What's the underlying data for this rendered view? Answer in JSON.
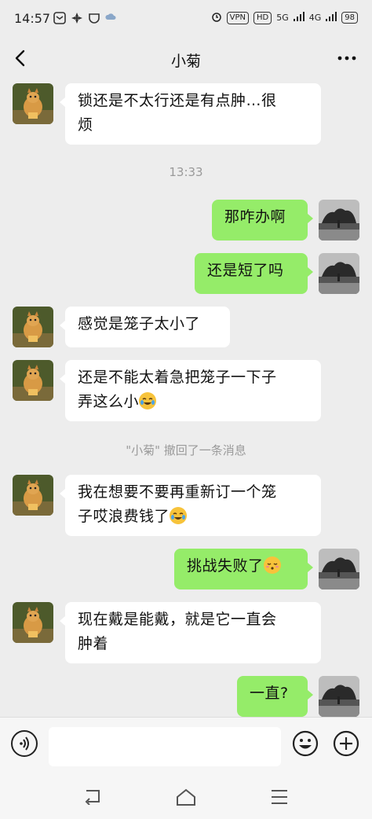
{
  "status_bar": {
    "time": "14:57",
    "vpn": "VPN",
    "hd": "HD",
    "net1": "5G",
    "net2": "4G",
    "battery": "98"
  },
  "header": {
    "title": "小菊"
  },
  "messages": [
    {
      "side": "left",
      "line1": "锁还是不太行还是有点肿…很",
      "line2": "烦"
    },
    {
      "type": "time",
      "text": "13:33"
    },
    {
      "side": "right",
      "text": "那咋办啊"
    },
    {
      "side": "right",
      "text": "还是短了吗"
    },
    {
      "side": "left",
      "text": "感觉是笼子太小了"
    },
    {
      "side": "left",
      "line1": "还是不能太着急把笼子一下子",
      "line2": "弄这么小"
    },
    {
      "type": "system",
      "text": "\"小菊\" 撤回了一条消息"
    },
    {
      "side": "left",
      "line1": "我在想要不要再重新订一个笼",
      "line2": "子哎浪费钱了"
    },
    {
      "side": "right",
      "text": "挑战失败了"
    },
    {
      "side": "left",
      "line1": "现在戴是能戴，就是它一直会",
      "line2": "肿着"
    },
    {
      "side": "right",
      "text": "一直?"
    }
  ],
  "icons": {
    "back": "back-arrow-icon",
    "more": "more-icon",
    "voice": "voice-icon",
    "emoji": "emoji-icon",
    "plus": "plus-icon",
    "nav_back": "nav-back-icon",
    "nav_home": "nav-home-icon",
    "nav_menu": "nav-menu-icon"
  },
  "colors": {
    "background": "#ededed",
    "bubble_self": "#95ec69",
    "bubble_other": "#ffffff"
  }
}
